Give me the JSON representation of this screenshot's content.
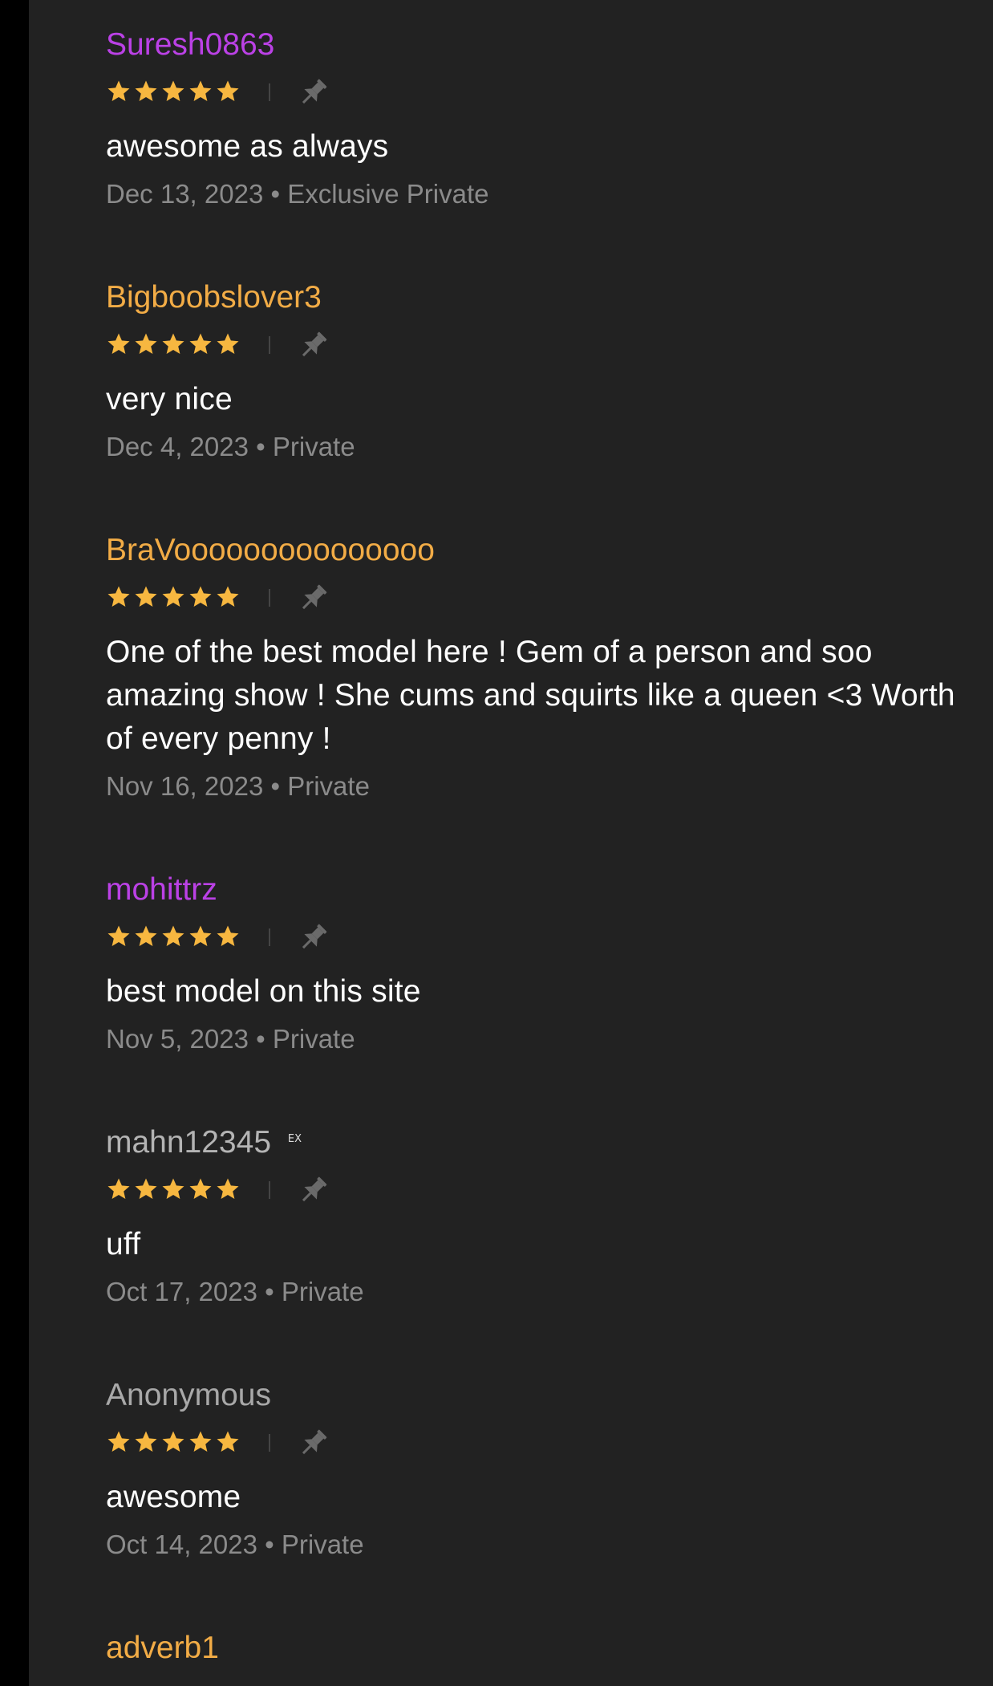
{
  "colors": {
    "background": "#222222",
    "left_strip": "#000000",
    "star": "#f7b740",
    "pin": "#6a6a6a",
    "meta_text": "#8b8b8b",
    "comment_text": "#ffffff"
  },
  "icons": {
    "star": "star-icon",
    "pin": "pin-icon"
  },
  "reviews": [
    {
      "username": "Suresh0863",
      "username_color": "#bb41e6",
      "rating": 5,
      "comment": "awesome as always",
      "date": "Dec 13, 2023",
      "separator": "•",
      "show_type": "Exclusive Private"
    },
    {
      "username": "Bigboobslover3",
      "username_color": "#f2ac46",
      "rating": 5,
      "comment": "very nice",
      "date": "Dec 4, 2023",
      "separator": "•",
      "show_type": "Private"
    },
    {
      "username": "BraVooooooooooooooo",
      "username_color": "#f2ac46",
      "rating": 5,
      "comment": "One of the best model here ! Gem of a person and soo amazing show ! She cums and squirts like a queen <3 Worth of every penny !",
      "date": "Nov 16, 2023",
      "separator": "•",
      "show_type": "Private"
    },
    {
      "username": "mohittrz",
      "username_color": "#bb41e6",
      "rating": 5,
      "comment": "best model on this site",
      "date": "Nov 5, 2023",
      "separator": "•",
      "show_type": "Private"
    },
    {
      "username": "mahn12345",
      "username_color": "#b4b4b4",
      "username_badge": "EX",
      "rating": 5,
      "comment": "uff",
      "date": "Oct 17, 2023",
      "separator": "•",
      "show_type": "Private"
    },
    {
      "username": "Anonymous",
      "username_color": "#a8a8a8",
      "rating": 5,
      "comment": "awesome",
      "date": "Oct 14, 2023",
      "separator": "•",
      "show_type": "Private"
    },
    {
      "username": "adverb1",
      "username_color": "#f2ac46"
    }
  ]
}
